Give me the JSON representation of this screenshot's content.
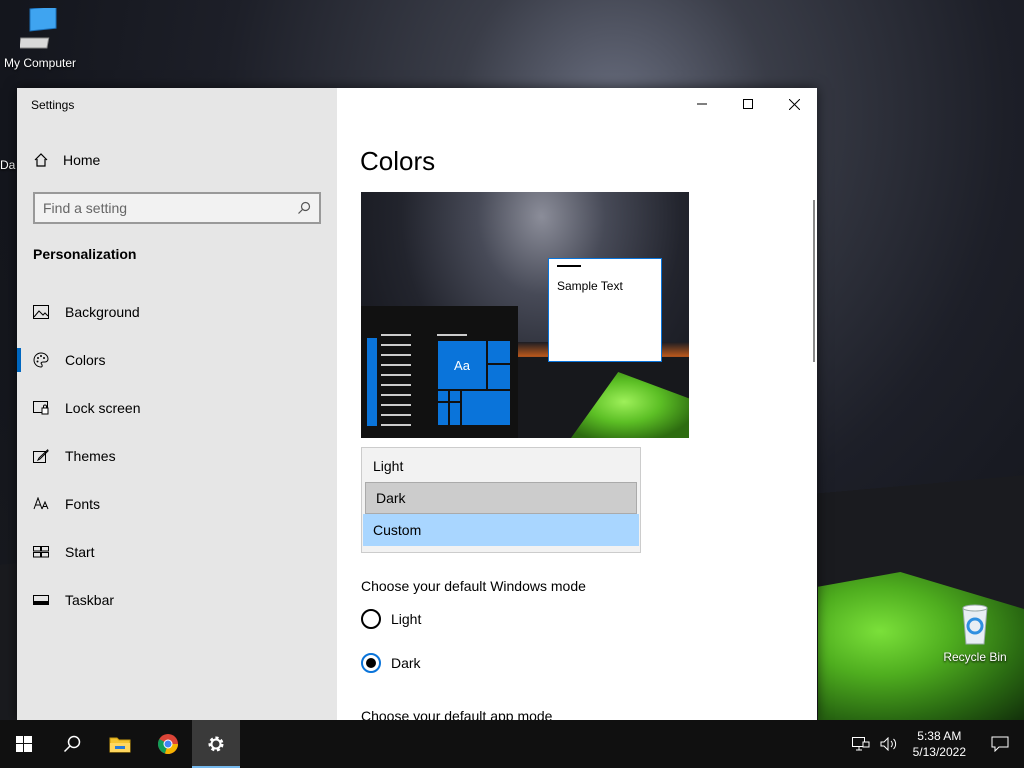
{
  "desktop": {
    "icons": [
      {
        "label": "My Computer"
      },
      {
        "label": "Recycle Bin"
      }
    ],
    "partial_label": "Da"
  },
  "window": {
    "title": "Settings",
    "home_label": "Home",
    "search_placeholder": "Find a setting",
    "section_title": "Personalization",
    "nav": [
      {
        "label": "Background",
        "icon": "image-icon"
      },
      {
        "label": "Colors",
        "icon": "palette-icon",
        "active": true
      },
      {
        "label": "Lock screen",
        "icon": "lock-screen-icon"
      },
      {
        "label": "Themes",
        "icon": "brush-icon"
      },
      {
        "label": "Fonts",
        "icon": "font-icon"
      },
      {
        "label": "Start",
        "icon": "start-icon"
      },
      {
        "label": "Taskbar",
        "icon": "taskbar-icon"
      }
    ]
  },
  "main": {
    "title": "Colors",
    "preview": {
      "tile_text": "Aa",
      "sample_text": "Sample Text"
    },
    "mode_dropdown": {
      "options": [
        "Light",
        "Dark",
        "Custom"
      ],
      "hovered": "Dark",
      "selected": "Custom"
    },
    "windows_mode": {
      "label": "Choose your default Windows mode",
      "options": [
        "Light",
        "Dark"
      ],
      "selected": "Dark"
    },
    "app_mode_label": "Choose your default app mode"
  },
  "taskbar": {
    "clock_time": "5:38 AM",
    "clock_date": "5/13/2022"
  },
  "colors": {
    "accent": "#0a74da",
    "selected_option": "#a9d6ff",
    "sidebar_bg": "#e6e6e6"
  }
}
